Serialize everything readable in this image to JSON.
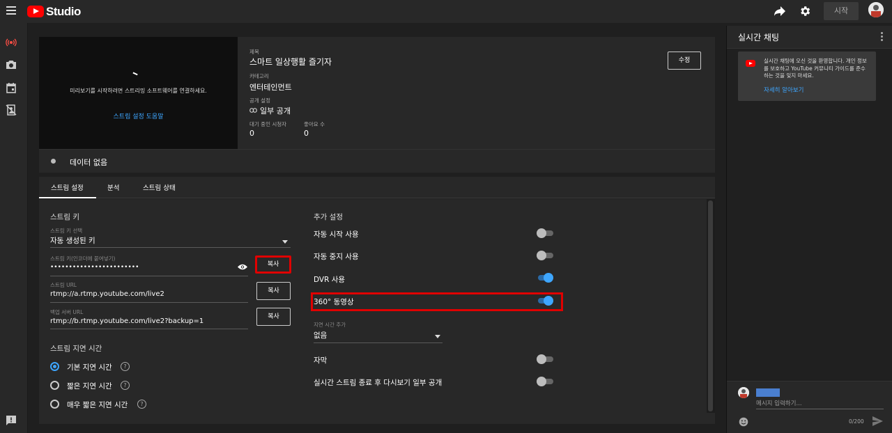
{
  "topbar": {
    "logo_text": "Studio",
    "start_label": "시작"
  },
  "preview": {
    "message": "미리보기를 시작하려면 스트리밍 소프트웨어를 연결하세요.",
    "help_link": "스트림 설정 도움말"
  },
  "info": {
    "title_label": "제목",
    "title_value": "스마트 일상행활 즐기자",
    "category_label": "카테고리",
    "category_value": "엔터테인먼트",
    "privacy_label": "공개 설정",
    "privacy_value": "일부 공개",
    "waiting_label": "대기 중인 시청자",
    "waiting_value": "0",
    "likes_label": "좋아요 수",
    "likes_value": "0",
    "edit_label": "수정"
  },
  "status": {
    "text": "데이터 없음"
  },
  "tabs": [
    {
      "label": "스트림 설정",
      "active": true
    },
    {
      "label": "분석",
      "active": false
    },
    {
      "label": "스트림 상태",
      "active": false
    }
  ],
  "stream": {
    "section_title": "스트림 키",
    "key_select_label": "스트림 키 선택",
    "key_select_value": "자동 생성된 키",
    "key_label": "스트림 키(인코더에 붙여넣기)",
    "key_value": "••••••••••••••••••••••••",
    "url_label": "스트림 URL",
    "url_value": "rtmp://a.rtmp.youtube.com/live2",
    "backup_label": "백업 서버 URL",
    "backup_value": "rtmp://b.rtmp.youtube.com/live2?backup=1",
    "copy_label": "복사",
    "latency_title": "스트림 지연 시간",
    "latency_options": [
      {
        "label": "기본 지연 시간",
        "selected": true
      },
      {
        "label": "짧은 지연 시간",
        "selected": false
      },
      {
        "label": "매우 짧은 지연 시간",
        "selected": false
      }
    ]
  },
  "extra": {
    "section_title": "추가 설정",
    "toggles": [
      {
        "label": "자동 시작 사용",
        "on": false
      },
      {
        "label": "자동 중지 사용",
        "on": false
      },
      {
        "label": "DVR 사용",
        "on": true
      },
      {
        "label": "360° 동영상",
        "on": true
      }
    ],
    "delay_label": "지연 시간 추가",
    "delay_value": "없음",
    "toggles2": [
      {
        "label": "자막",
        "on": false
      },
      {
        "label": "실시간 스트림 종료 후 다시보기 일부 공개",
        "on": false
      }
    ]
  },
  "chat": {
    "title": "실시간 채팅",
    "welcome_text": "실시간 채팅에 오신 것을 환영합니다. 개인 정보를 보호하고 YouTube 커뮤니티 가이드를 준수하는 것을 잊지 마세요.",
    "welcome_link": "자세히 알아보기",
    "input_placeholder": "메시지 입력하기...",
    "char_count": "0/200"
  },
  "colors": {
    "accent": "#3ea6ff",
    "highlight": "#e00000",
    "brand": "#ff0000"
  }
}
